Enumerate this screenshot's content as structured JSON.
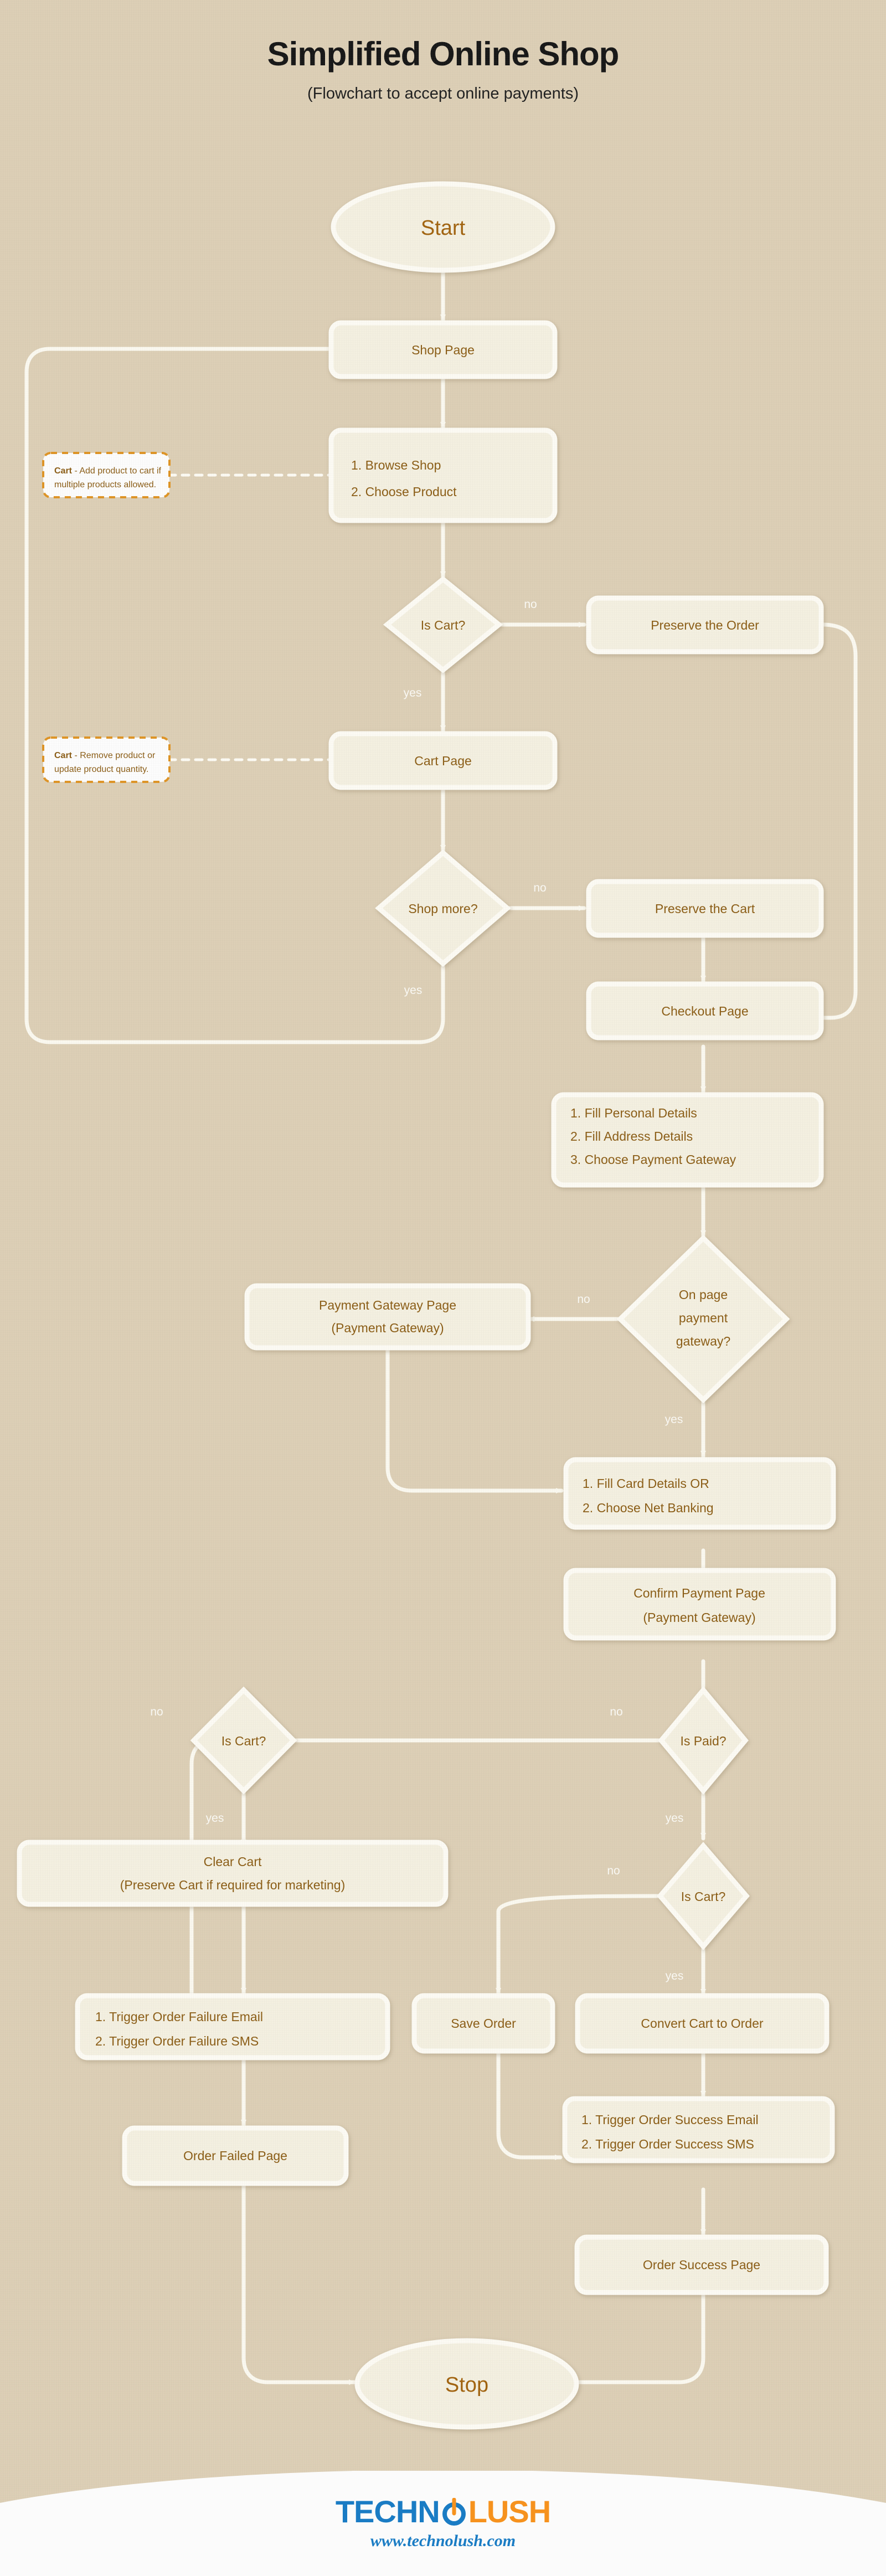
{
  "header": {
    "title": "Simplified Online Shop",
    "subtitle": "(Flowchart to accept online payments)"
  },
  "nodes": {
    "start": "Start",
    "shop_page": "Shop Page",
    "browse_1": "1. Browse Shop",
    "browse_2": "2. Choose Product",
    "is_cart_1": "Is Cart?",
    "preserve_order": "Preserve the Order",
    "cart_page": "Cart Page",
    "shop_more": "Shop more?",
    "preserve_cart": "Preserve the Cart",
    "checkout_page": "Checkout Page",
    "fill_1": "1. Fill Personal Details",
    "fill_2": "2. Fill Address Details",
    "fill_3": "3. Choose Payment Gateway",
    "onpage_gateway_l1": "On page",
    "onpage_gateway_l2": "payment",
    "onpage_gateway_l3": "gateway?",
    "pg_page_l1": "Payment Gateway Page",
    "pg_page_l2": "(Payment Gateway)",
    "card_1": "1. Fill Card Details OR",
    "card_2": "2. Choose Net Banking",
    "confirm_l1": "Confirm Payment Page",
    "confirm_l2": "(Payment Gateway)",
    "is_paid": "Is Paid?",
    "is_cart_2": "Is Cart?",
    "is_cart_3": "Is Cart?",
    "clear_cart_l1": "Clear Cart",
    "clear_cart_l2": "(Preserve Cart if required for marketing)",
    "failure_1": "1. Trigger Order Failure Email",
    "failure_2": "2. Trigger Order Failure SMS",
    "save_order": "Save Order",
    "convert_cart": "Convert Cart to Order",
    "success_1": "1. Trigger Order Success Email",
    "success_2": "2. Trigger Order Success SMS",
    "order_failed_page": "Order Failed Page",
    "order_success_page": "Order Success Page",
    "stop": "Stop"
  },
  "notes": {
    "note1_bold": "Cart",
    "note1_l1": " - Add product to cart if",
    "note1_l2": "multiple products allowed.",
    "note2_bold": "Cart",
    "note2_l1": " - Remove product or",
    "note2_l2": "update product quantity."
  },
  "edge_labels": {
    "is_cart_1_no": "no",
    "is_cart_1_yes": "yes",
    "shop_more_no": "no",
    "shop_more_yes": "yes",
    "gateway_no": "no",
    "gateway_yes": "yes",
    "is_paid_no": "no",
    "is_paid_yes": "yes",
    "is_cart_2_no": "no",
    "is_cart_2_yes": "yes",
    "is_cart_3_no": "no",
    "is_cart_3_yes": "yes"
  },
  "footer": {
    "logo_part1": "TECHN",
    "logo_part2": "LUSH",
    "url": "www.technolush.com"
  },
  "colors": {
    "background": "#ded0b6",
    "node_fill": "#f6f2e2",
    "node_stroke": "#fffdf6",
    "node_text": "#8a5a10",
    "edge": "#fdfbf2",
    "note_border": "#e09320",
    "note_fill": "#ffffff",
    "logo_blue": "#1a7cc4",
    "logo_orange": "#f6921e",
    "title": "#121212"
  }
}
